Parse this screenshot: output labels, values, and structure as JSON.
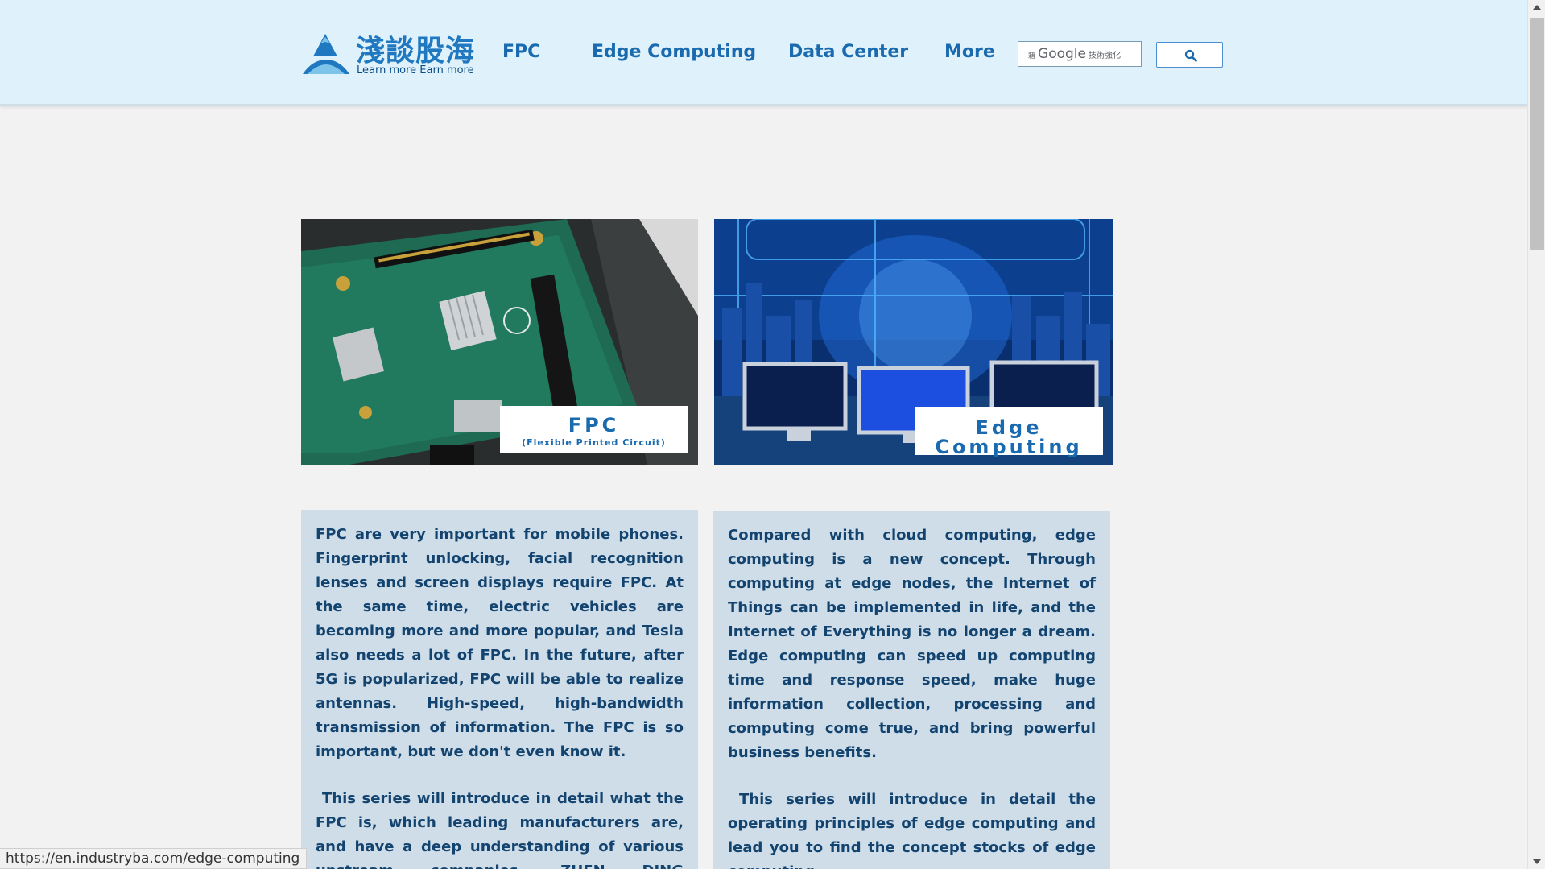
{
  "header": {
    "logo_cjk": "淺談股海",
    "logo_tagline": "Learn more Earn more",
    "nav": [
      "FPC",
      "Edge Computing",
      "Data Center",
      "More"
    ],
    "search": {
      "brand_prefix": "藉",
      "brand": "Google",
      "brand_suffix": "技術強化"
    }
  },
  "cards": [
    {
      "label": "FPC",
      "sublabel": "(Flexible Printed Circuit)",
      "paragraphs": [
        "FPC are very important for mobile phones. Fingerprint unlocking, facial recognition lenses and screen displays require FPC. At the same time, electric vehicles are becoming more and more popular, and Tesla also needs a lot of FPC. In the future, after 5G is popularized, FPC will be able to realize antennas. High-speed, high-bandwidth transmission of information. The FPC is so important, but we don't even know it.",
        "This series will introduce in detail what the FPC is, which leading manufacturers are, and have a deep understanding of various upstream companies. ZHEN DING TECHNOLOGY"
      ]
    },
    {
      "label_line1": "Edge",
      "label_line2": "Computing",
      "paragraphs": [
        "Compared with cloud computing, edge computing is a new concept. Through computing at edge nodes, the Internet of Things can be implemented in life, and the Internet of Everything is no longer a dream. Edge computing can speed up computing time and response speed, make huge information collection, processing and computing come true, and bring powerful business benefits.",
        "This series will introduce in detail the operating principles of edge computing and lead you to find the concept stocks of edge computing."
      ]
    }
  ],
  "status_bar": {
    "url": "https://en.industryba.com/edge-computing"
  },
  "colors": {
    "header_bg": "#dff2fc",
    "nav_text": "#1a6aaf",
    "panel_bg": "#cfdde9",
    "panel_text": "#13446f",
    "page_bg": "#f2f2f2"
  },
  "icons": [
    "logo-mountain-icon",
    "search-magnifier-icon"
  ]
}
